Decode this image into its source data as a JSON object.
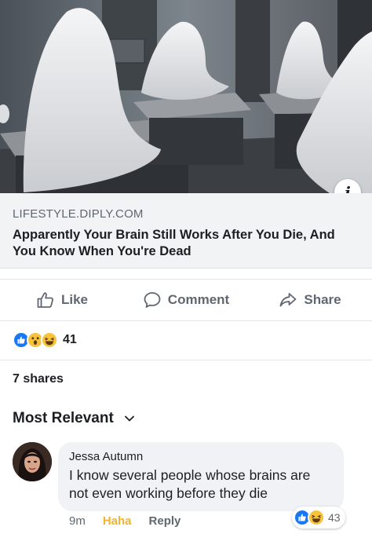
{
  "post": {
    "link_domain": "LIFESTYLE.DIPLY.COM",
    "link_title": "Apparently Your Brain Still Works After You Die, And You Know When You're Dead",
    "info_icon": "info-icon",
    "actions": {
      "like_label": "Like",
      "comment_label": "Comment",
      "share_label": "Share"
    },
    "reactions": {
      "types": [
        "like",
        "wow",
        "haha"
      ],
      "count": "41"
    },
    "shares_text": "7 shares"
  },
  "comments": {
    "sort_label": "Most Relevant",
    "items": [
      {
        "author": "Jessa Autumn",
        "text": "I know several people whose brains are not even working before they die",
        "time": "9m",
        "reaction_label": "Haha",
        "reply_label": "Reply",
        "reactions": [
          "like",
          "haha"
        ],
        "reaction_count": "43"
      }
    ]
  },
  "colors": {
    "like_blue": "#1877f2",
    "haha_yellow": "#f7c33c",
    "muted_text": "#606770",
    "caption_bg": "#f2f3f5"
  }
}
